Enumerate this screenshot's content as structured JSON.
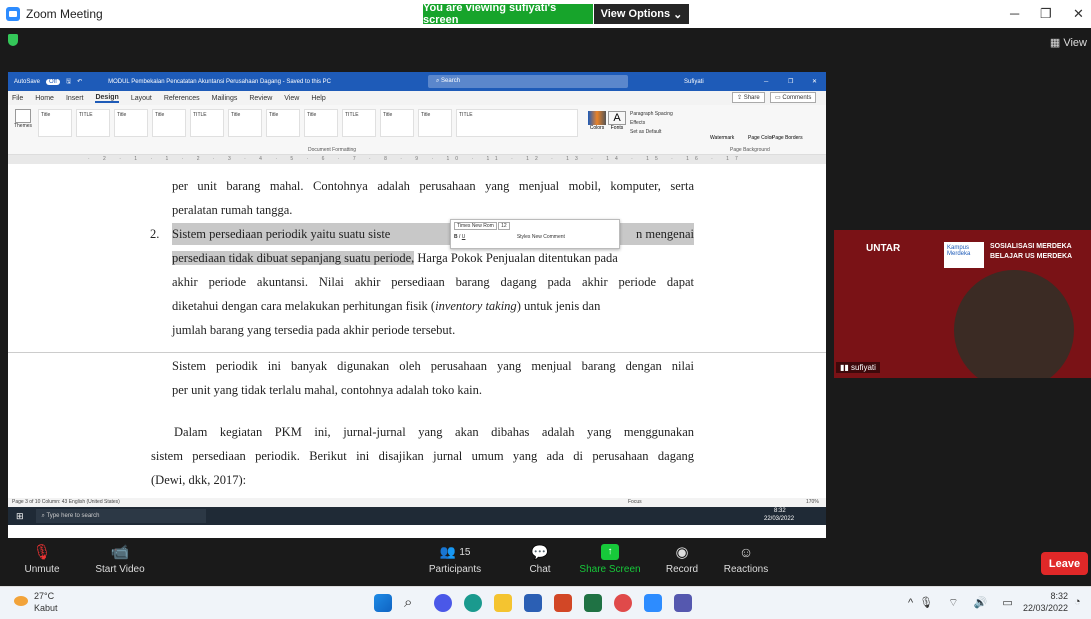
{
  "window": {
    "title": "Zoom Meeting",
    "viewing_banner": "You are viewing sufiyati's screen",
    "view_options": "View Options",
    "view_btn": "View"
  },
  "word": {
    "autosave": "AutoSave",
    "autosave_state": "Off",
    "doc_title": "MODUL Pembekalan Pencatatan Akuntansi Perusahaan Dagang - Saved to this PC",
    "search": "Search",
    "user": "Sufiyati",
    "tabs": [
      "File",
      "Home",
      "Insert",
      "Design",
      "Layout",
      "References",
      "Mailings",
      "Review",
      "View",
      "Help"
    ],
    "active_tab": "Design",
    "share": "Share",
    "comments": "Comments",
    "ribbon": {
      "themes": "Themes",
      "styles": [
        "Title",
        "TITLE",
        "Title",
        "Title",
        "TITLE",
        "Title",
        "Title",
        "Title",
        "TITLE",
        "Title",
        "Title",
        "TITLE"
      ],
      "colors": "Colors",
      "fonts": "Fonts",
      "paragraph_spacing": "Paragraph Spacing",
      "effects": "Effects",
      "set_default": "Set as Default",
      "doc_formatting": "Document Formatting",
      "watermark": "Watermark",
      "page_color": "Page Color",
      "page_borders": "Page Borders",
      "page_background": "Page Background"
    },
    "mini_toolbar": {
      "font": "Times New Rom",
      "size": "12",
      "styles": "Styles",
      "new_comment": "New Comment"
    },
    "lines": [
      "per unit barang mahal. Contohnya adalah perusahaan yang menjual mobil, komputer, serta",
      "peralatan rumah tangga.",
      "2.",
      "Sistem persediaan periodik yaitu suatu siste",
      "n mengenai",
      "persediaan tidak dibuat sepanjang suatu periode,",
      "Harga Pokok Penjualan ditentukan pada",
      "akhir periode akuntansi. Nilai akhir persediaan barang dagang pada akhir periode dapat",
      "diketahui dengan cara melakukan perhitungan fisik (",
      "inventory taking",
      ") untuk jenis dan",
      "jumlah barang yang tersedia pada akhir periode tersebut.",
      "Sistem periodik ini banyak digunakan oleh perusahaan yang menjual barang dengan nilai",
      "per unit yang tidak terlalu mahal, contohnya adalah toko kain.",
      "Dalam kegiatan PKM ini, jurnal-jurnal yang akan dibahas adalah yang menggunakan",
      "sistem persediaan periodik. Berikut ini disajikan jurnal umum yang ada di perusahaan dagang",
      "(Dewi, dkk, 2017):"
    ],
    "status": "Page 3 of 10   Column: 43   English (United States)",
    "focus": "Focus",
    "zoom": "170%",
    "taskbar": {
      "search": "Type here to search",
      "time": "8:32",
      "date": "22/03/2022"
    }
  },
  "video": {
    "name": "sufiyati",
    "logo": "UNTAR",
    "kampus": "Kampus Merdeka",
    "banner": "SOSIALISASI MERDEKA BELAJAR  US MERDEKA"
  },
  "zoom_bar": {
    "unmute": "Unmute",
    "start_video": "Start Video",
    "participants": "Participants",
    "participants_count": "15",
    "chat": "Chat",
    "share_screen": "Share Screen",
    "record": "Record",
    "reactions": "Reactions",
    "leave": "Leave"
  },
  "taskbar": {
    "temp": "27°C",
    "weather": "Kabut",
    "time": "8:32",
    "date": "22/03/2022"
  }
}
